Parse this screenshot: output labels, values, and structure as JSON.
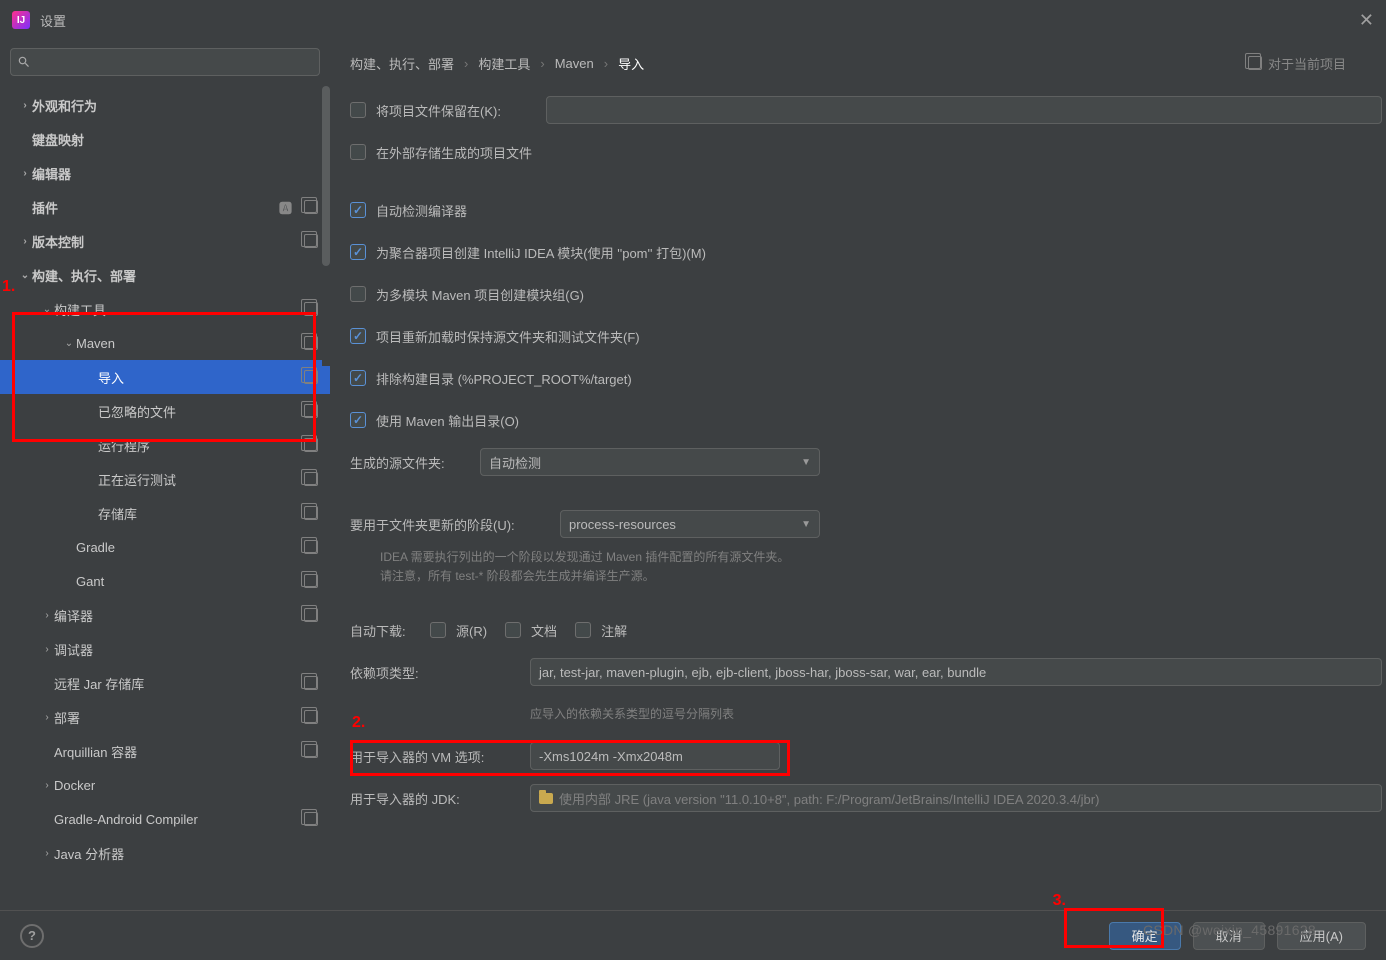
{
  "window": {
    "title": "设置"
  },
  "breadcrumb": {
    "a": "构建、执行、部署",
    "b": "构建工具",
    "c": "Maven",
    "d": "导入",
    "scope": "对于当前项目"
  },
  "sidebar": {
    "items": [
      {
        "label": "外观和行为",
        "depth": 0,
        "arrow": "closed",
        "bold": true
      },
      {
        "label": "键盘映射",
        "depth": 0,
        "arrow": "",
        "bold": true
      },
      {
        "label": "编辑器",
        "depth": 0,
        "arrow": "closed",
        "bold": true
      },
      {
        "label": "插件",
        "depth": 0,
        "arrow": "",
        "bold": true,
        "lang": true,
        "copy": true
      },
      {
        "label": "版本控制",
        "depth": 0,
        "arrow": "closed",
        "bold": true,
        "copy": true
      },
      {
        "label": "构建、执行、部署",
        "depth": 0,
        "arrow": "open",
        "bold": true
      },
      {
        "label": "构建工具",
        "depth": 1,
        "arrow": "open",
        "copy": true
      },
      {
        "label": "Maven",
        "depth": 2,
        "arrow": "open",
        "copy": true
      },
      {
        "label": "导入",
        "depth": 3,
        "arrow": "",
        "copy": true,
        "selected": true
      },
      {
        "label": "已忽略的文件",
        "depth": 3,
        "arrow": "",
        "copy": true
      },
      {
        "label": "运行程序",
        "depth": 3,
        "arrow": "",
        "copy": true
      },
      {
        "label": "正在运行测试",
        "depth": 3,
        "arrow": "",
        "copy": true
      },
      {
        "label": "存储库",
        "depth": 3,
        "arrow": "",
        "copy": true
      },
      {
        "label": "Gradle",
        "depth": 2,
        "arrow": "",
        "copy": true
      },
      {
        "label": "Gant",
        "depth": 2,
        "arrow": "",
        "copy": true
      },
      {
        "label": "编译器",
        "depth": 1,
        "arrow": "closed",
        "copy": true
      },
      {
        "label": "调试器",
        "depth": 1,
        "arrow": "closed"
      },
      {
        "label": "远程 Jar 存储库",
        "depth": 1,
        "arrow": "",
        "copy": true
      },
      {
        "label": "部署",
        "depth": 1,
        "arrow": "closed",
        "copy": true
      },
      {
        "label": "Arquillian 容器",
        "depth": 1,
        "arrow": "",
        "copy": true
      },
      {
        "label": "Docker",
        "depth": 1,
        "arrow": "closed"
      },
      {
        "label": "Gradle-Android Compiler",
        "depth": 1,
        "arrow": "",
        "copy": true
      },
      {
        "label": "Java 分析器",
        "depth": 1,
        "arrow": "closed"
      }
    ]
  },
  "form": {
    "keepProject": {
      "label": "将项目文件保留在(K):",
      "checked": false
    },
    "externalStore": {
      "label": "在外部存储生成的项目文件",
      "checked": false
    },
    "autoDetect": {
      "label": "自动检测编译器",
      "checked": true
    },
    "aggregator": {
      "label": "为聚合器项目创建 IntelliJ IDEA 模块(使用 ''pom'' 打包)(M)",
      "checked": true
    },
    "multiModule": {
      "label": "为多模块 Maven 项目创建模块组(G)",
      "checked": false
    },
    "keepSrcTest": {
      "label": "项目重新加载时保持源文件夹和测试文件夹(F)",
      "checked": true
    },
    "excludeBuild": {
      "label": "排除构建目录 (%PROJECT_ROOT%/target)",
      "checked": true
    },
    "useOutput": {
      "label": "使用 Maven 输出目录(O)",
      "checked": true
    },
    "genSrcLabel": "生成的源文件夹:",
    "genSrcValue": "自动检测",
    "phaseLabel": "要用于文件夹更新的阶段(U):",
    "phaseValue": "process-resources",
    "hint1": "IDEA 需要执行列出的一个阶段以发现通过 Maven 插件配置的所有源文件夹。",
    "hint2": "请注意，所有 test-* 阶段都会先生成并编译生产源。",
    "autoDLLabel": "自动下载:",
    "autoDL": {
      "src": "源(R)",
      "doc": "文档",
      "anno": "注解"
    },
    "depsLabel": "依赖项类型:",
    "depsValue": "jar, test-jar, maven-plugin, ejb, ejb-client, jboss-har, jboss-sar, war, ear, bundle",
    "depsHint": "应导入的依赖关系类型的逗号分隔列表",
    "vmLabel": "用于导入器的 VM 选项:",
    "vmValue": "-Xms1024m -Xmx2048m",
    "jdkLabel": "用于导入器的 JDK:",
    "jdkValue": "使用内部 JRE (java version \"11.0.10+8\", path: F:/Program/JetBrains/IntelliJ IDEA 2020.3.4/jbr)"
  },
  "footer": {
    "ok": "确定",
    "cancel": "取消",
    "apply": "应用(A)"
  },
  "anno": {
    "a1": "1.",
    "a2": "2.",
    "a3": "3."
  },
  "watermark": "CSDN @weixin_45891628"
}
